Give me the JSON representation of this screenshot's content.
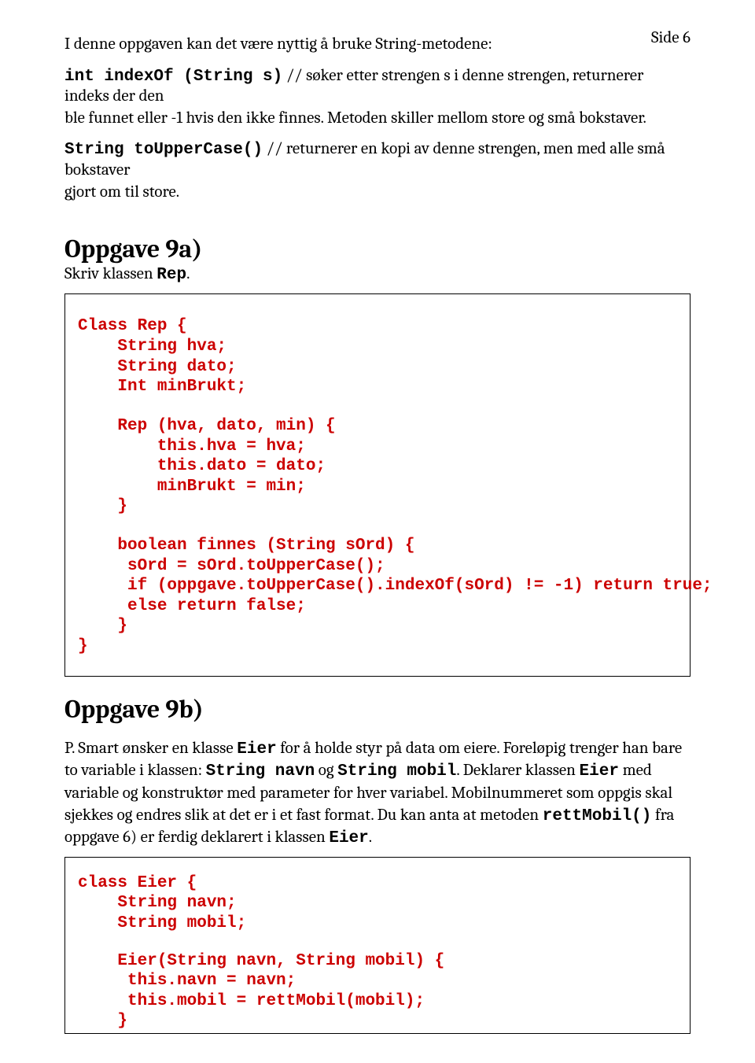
{
  "page_label": "Side 6",
  "intro": {
    "line1": "I denne oppgaven kan det være nyttig å bruke String-metodene:"
  },
  "indexof": {
    "code": "int indexOf (String s)",
    "desc_a": " // søker etter strengen s i denne strengen, returnerer indeks der den",
    "desc_b": "ble funnet eller -1 hvis den ikke finnes. Metoden skiller mellom store og små bokstaver."
  },
  "touppercase": {
    "code": "String toUpperCase()",
    "desc_a": "   // returnerer en kopi av denne strengen, men med alle små bokstaver",
    "desc_b": "gjort om til store."
  },
  "task9a": {
    "title": "Oppgave 9a)",
    "sub_a": "Skriv klassen ",
    "sub_code": "Rep",
    "sub_b": "."
  },
  "code9a": {
    "l1": "Class Rep {",
    "l2": "    String hva;",
    "l3": "    String dato;",
    "l4": "    Int minBrukt;",
    "l5": "    Rep (hva, dato, min) {",
    "l6": "        this.hva = hva;",
    "l7": "        this.dato = dato;",
    "l8": "        minBrukt = min;",
    "l9": "    }",
    "l10": "    boolean finnes (String sOrd) {",
    "l11": "     sOrd = sOrd.toUpperCase();",
    "l12": "     if (oppgave.toUpperCase().indexOf(sOrd) != -1) return true;",
    "l13": "     else return false;",
    "l14": "    }",
    "l15": "}"
  },
  "task9b": {
    "title": "Oppgave 9b)"
  },
  "para9b": {
    "t1": "P. Smart ønsker en klasse ",
    "c1": "Eier",
    "t2": "  for å holde styr på data om eiere. Foreløpig trenger han bare",
    "t3": "to variable i klassen: ",
    "c2": "String navn",
    "t4": " og ",
    "c3": "String mobil",
    "t5": ".  Deklarer klassen ",
    "c4": "Eier",
    "t6": " med",
    "t7": "variable og konstruktør med parameter for hver variabel. Mobilnummeret som oppgis skal",
    "t8": "sjekkes og endres slik at det er i et fast format. Du kan anta at metoden ",
    "c5": "rettMobil()",
    "t9": " fra",
    "t10": "oppgave 6) er ferdig deklarert i klassen ",
    "c6": "Eier",
    "t11": "."
  },
  "code9b": {
    "l1": "class Eier {",
    "l2": "    String navn;",
    "l3": "    String mobil;",
    "l4": "    Eier(String navn, String mobil) {",
    "l5": "     this.navn = navn;",
    "l6": "     this.mobil = rettMobil(mobil);",
    "l7": "    }"
  }
}
